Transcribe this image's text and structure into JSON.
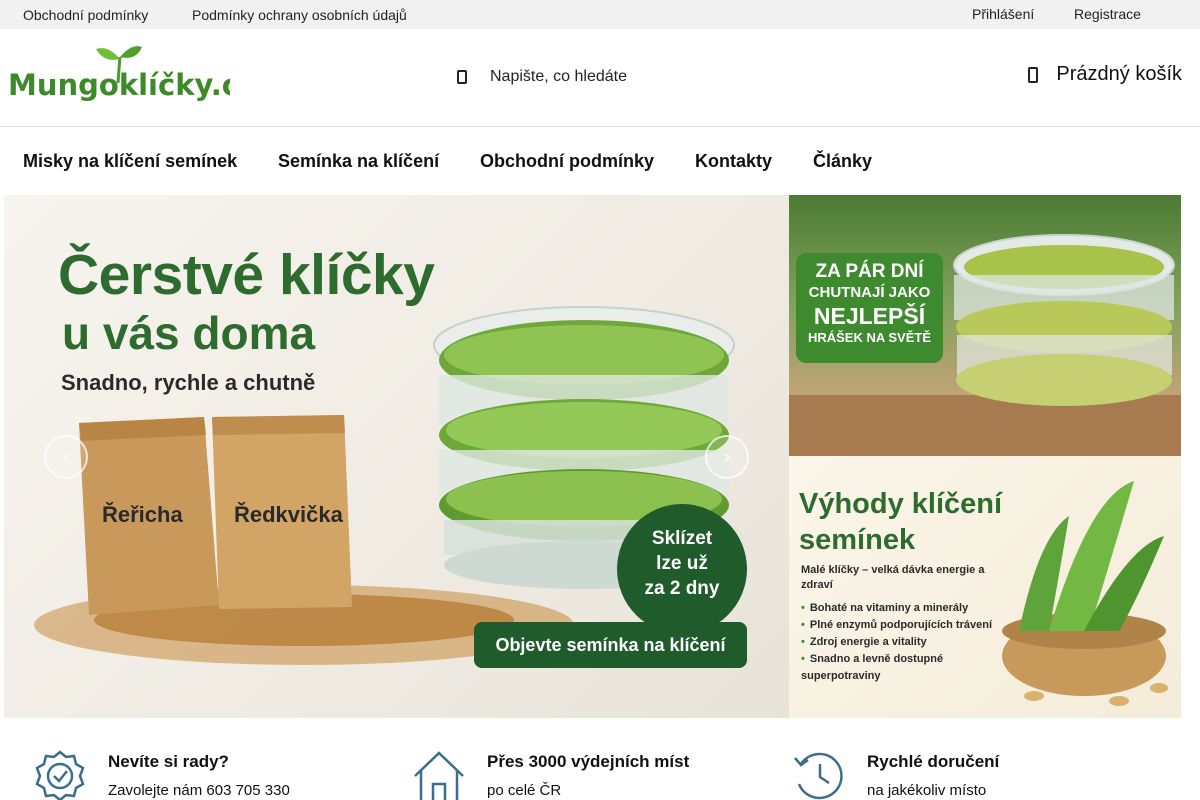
{
  "topbar": {
    "left_links": [
      "Obchodní podmínky",
      "Podmínky ochrany osobních údajů"
    ],
    "login": "Přihlášení",
    "register": "Registrace"
  },
  "header": {
    "logo_text": "Mungoklíčky.cz",
    "search_placeholder": "Napište, co hledáte",
    "cart_label": "Prázdný košík"
  },
  "nav": {
    "items": [
      "Misky na klíčení semínek",
      "Semínka na klíčení",
      "Obchodní podmínky",
      "Kontakty",
      "Články"
    ]
  },
  "hero": {
    "title_line1": "Čerstvé klíčky",
    "title_line2": "u vás doma",
    "subtitle": "Snadno, rychle a chutně",
    "bag1": "Řeřicha",
    "bag2": "Ředkvička",
    "badge_line1": "Sklízet",
    "badge_line2": "lze už",
    "badge_line3": "za 2 dny",
    "cta": "Objevte semínka na klíčení"
  },
  "side_banner_1": {
    "line1": "ZA PÁR DNÍ",
    "line2": "CHUTNAJÍ JAKO",
    "line3": "NEJLEPŠÍ",
    "line4": "HRÁŠEK NA SVĚTĚ"
  },
  "side_banner_2": {
    "title": "Výhody klíčení semínek",
    "intro": "Malé klíčky – velká dávka energie a zdraví",
    "bullets": [
      "Bohaté na vitaminy a minerály",
      "Plné enzymů podporujících trávení",
      "Zdroj energie a vitality",
      "Snadno a levně dostupné superpotraviny"
    ]
  },
  "benefits": [
    {
      "title": "Nevíte si rady?",
      "desc": "Zavolejte nám 603 705 330",
      "icon": "badge-check-icon"
    },
    {
      "title": "Přes 3000 výdejních míst",
      "desc": "po celé ČR",
      "icon": "house-icon"
    },
    {
      "title": "Rychlé doručení",
      "desc": "na jakékoliv místo",
      "icon": "clock-icon"
    }
  ],
  "colors": {
    "brand_green": "#2e6b2e",
    "dark_green": "#1f5b2b",
    "topbar_bg": "#f1f1f1"
  }
}
